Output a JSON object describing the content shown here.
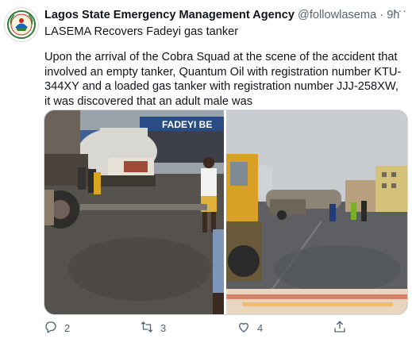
{
  "account": {
    "name": "Lagos State Emergency Management Agency",
    "handle": "@followlasema",
    "separator": "·",
    "time": "9h"
  },
  "tweet": {
    "headline": "LASEMA Recovers Fadeyi gas tanker",
    "body": "Upon the arrival of the Cobra Squad at the scene of the accident that involved an empty tanker, Quantum Oil with registration number KTU-344XY and a loaded gas tanker with registration number JJJ-258XW, it was discovered that an adult male was"
  },
  "media": {
    "left_photo_sign": "FADEYI BE"
  },
  "actions": {
    "reply_count": "2",
    "retweet_count": "3",
    "like_count": "4",
    "share_count": ""
  },
  "icons": {
    "reply": "reply-icon",
    "retweet": "retweet-icon",
    "like": "heart-icon",
    "share": "share-icon",
    "more": "more-icon"
  },
  "colors": {
    "text": "#0f1419",
    "muted": "#536471",
    "border": "#cfd9de"
  }
}
